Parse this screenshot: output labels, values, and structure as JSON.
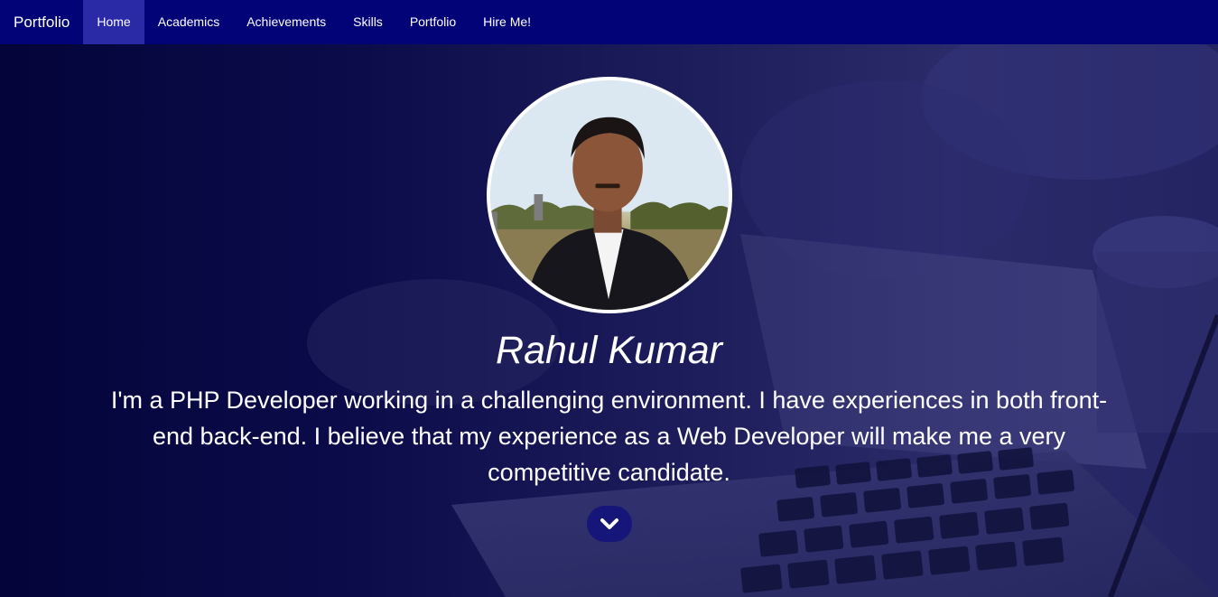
{
  "navbar": {
    "brand": "Portfolio",
    "items": [
      {
        "label": "Home",
        "active": true
      },
      {
        "label": "Academics",
        "active": false
      },
      {
        "label": "Achievements",
        "active": false
      },
      {
        "label": "Skills",
        "active": false
      },
      {
        "label": "Portfolio",
        "active": false
      },
      {
        "label": "Hire Me!",
        "active": false
      }
    ]
  },
  "hero": {
    "name": "Rahul Kumar",
    "bio": "I'm a PHP Developer working in a challenging environment. I have experiences in both front-end back-end. I believe that my experience as a Web Developer will make me a very competitive candidate.",
    "scroll_icon": "chevron-down-icon",
    "background_image": "laptop-keyboard-photo",
    "profile_image": "profile-photo"
  },
  "colors": {
    "navbar_bg": "#030378",
    "nav_active_bg": "#2a2aa6",
    "hero_overlay": "#0b0b4a",
    "scroll_button_bg": "#15157a",
    "text": "#ffffff"
  }
}
